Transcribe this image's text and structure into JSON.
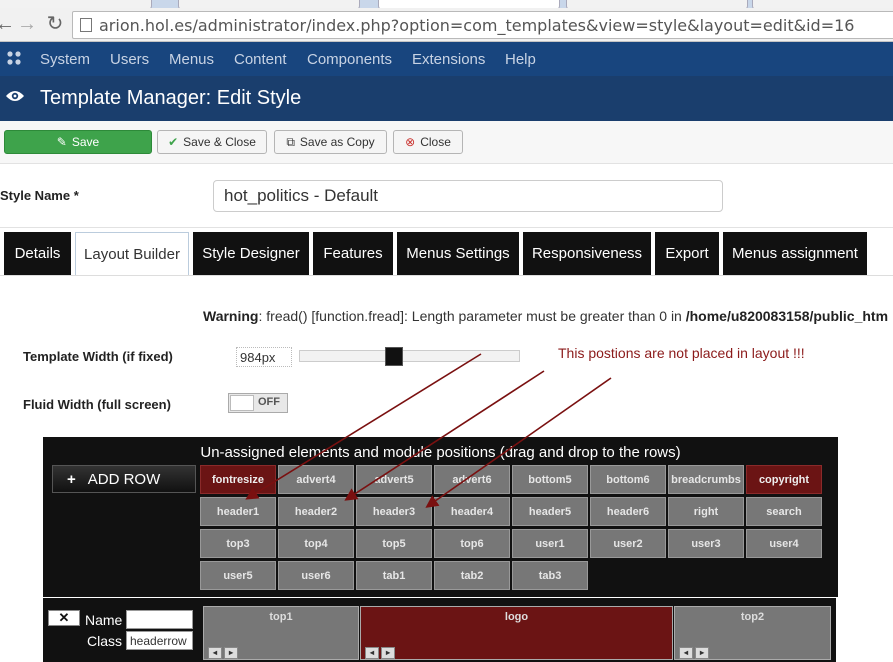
{
  "browser": {
    "url": "arion.hol.es/administrator/index.php?option=com_templates&view=style&layout=edit&id=16"
  },
  "topnav": {
    "items": [
      "System",
      "Users",
      "Menus",
      "Content",
      "Components",
      "Extensions",
      "Help"
    ]
  },
  "header": {
    "title": "Template Manager: Edit Style"
  },
  "toolbar": {
    "save": "Save",
    "save_close": "Save & Close",
    "save_copy": "Save as Copy",
    "close": "Close"
  },
  "style_name": {
    "label": "Style Name *",
    "value": "hot_politics - Default"
  },
  "tabs": [
    "Details",
    "Layout Builder",
    "Style Designer",
    "Features",
    "Menus Settings",
    "Responsiveness",
    "Export",
    "Menus assignment"
  ],
  "active_tab": "Layout Builder",
  "warning": {
    "prefix": "Warning",
    "message": ": fread() [function.fread]: Length parameter must be greater than 0 in ",
    "path": "/home/u820083158/public_htm"
  },
  "template_width": {
    "label": "Template Width (if fixed)",
    "value": "984px",
    "slider_fraction": 0.42
  },
  "fluid_width": {
    "label": "Fluid Width (full screen)",
    "state": "OFF"
  },
  "annotation": "This postions are not placed in layout !!!",
  "unassigned": {
    "title": "Un-assigned elements and module positions (drag and drop to the rows)",
    "add_row": "ADD ROW",
    "positions": [
      [
        "fontresize",
        "advert4",
        "advert5",
        "advert6",
        "bottom5",
        "bottom6",
        "breadcrumbs",
        "copyright"
      ],
      [
        "header1",
        "header2",
        "header3",
        "header4",
        "header5",
        "header6",
        "right",
        "search"
      ],
      [
        "top3",
        "top4",
        "top5",
        "top6",
        "user1",
        "user2",
        "user3",
        "user4"
      ],
      [
        "user5",
        "user6",
        "tab1",
        "tab2",
        "tab3"
      ]
    ],
    "highlighted": [
      "fontresize",
      "copyright"
    ]
  },
  "row": {
    "name_label": "Name",
    "name_value": "",
    "class_label": "Class",
    "class_value": "headerrow",
    "columns": [
      "top1",
      "logo",
      "top2"
    ],
    "highlighted_column": "logo"
  },
  "colors": {
    "topnav": "#18457e",
    "header": "#1a3e6d",
    "save_green": "#3ea34b",
    "highlight_red": "#6b1414",
    "annotation_red": "#8b1a1a"
  }
}
